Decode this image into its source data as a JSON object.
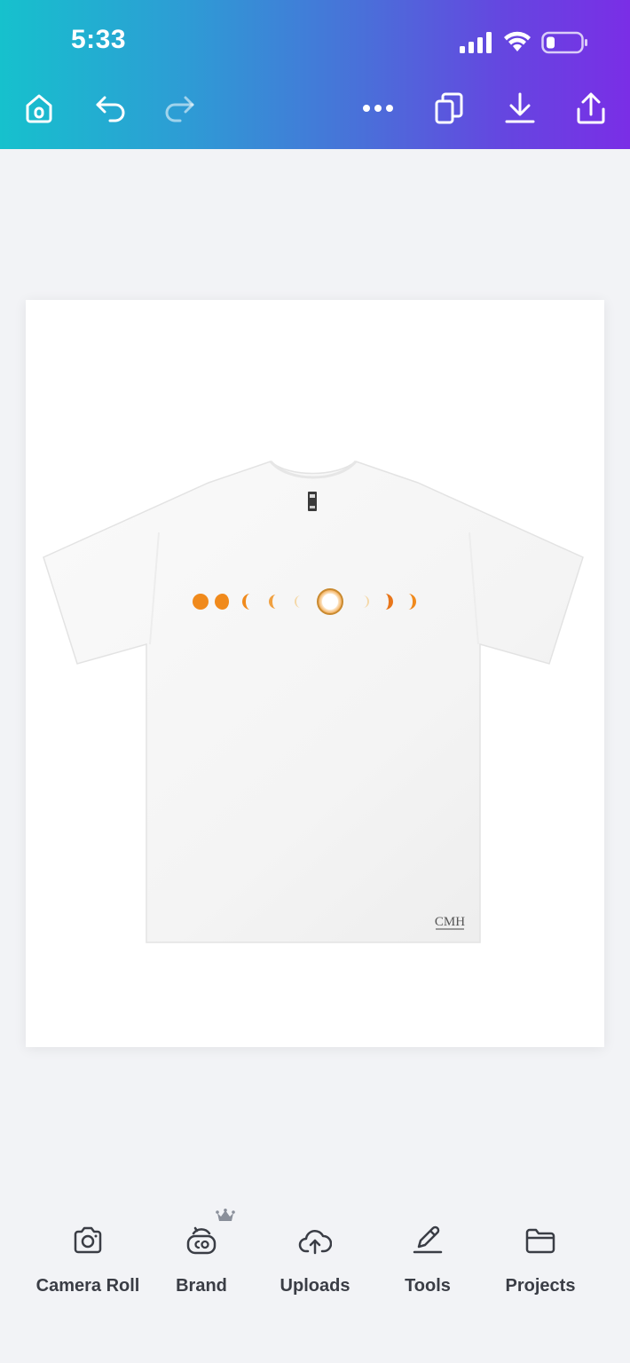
{
  "status_bar": {
    "time": "5:33"
  },
  "toolbar": {
    "home_icon": "home-icon",
    "undo_icon": "undo-icon",
    "redo_icon": "redo-icon",
    "more_icon": "more-icon",
    "duplicate_icon": "duplicate-pages-icon",
    "download_icon": "download-icon",
    "share_icon": "share-icon"
  },
  "design": {
    "image_description_icon": "tshirt-design-image",
    "brand_mark": "CMH"
  },
  "bottom_tools": [
    {
      "label": "Camera Roll",
      "icon": "camera-icon"
    },
    {
      "label": "Brand",
      "icon": "brand-icon"
    },
    {
      "label": "Uploads",
      "icon": "upload-cloud-icon"
    },
    {
      "label": "Tools",
      "icon": "pen-tool-icon"
    },
    {
      "label": "Projects",
      "icon": "folder-icon"
    }
  ],
  "colors": {
    "gradient_start": "#16c1cd",
    "gradient_end": "#7a2ee6",
    "background": "#f2f3f6",
    "label": "#3a3d45",
    "eclipse_orange": "#f08a1c"
  }
}
